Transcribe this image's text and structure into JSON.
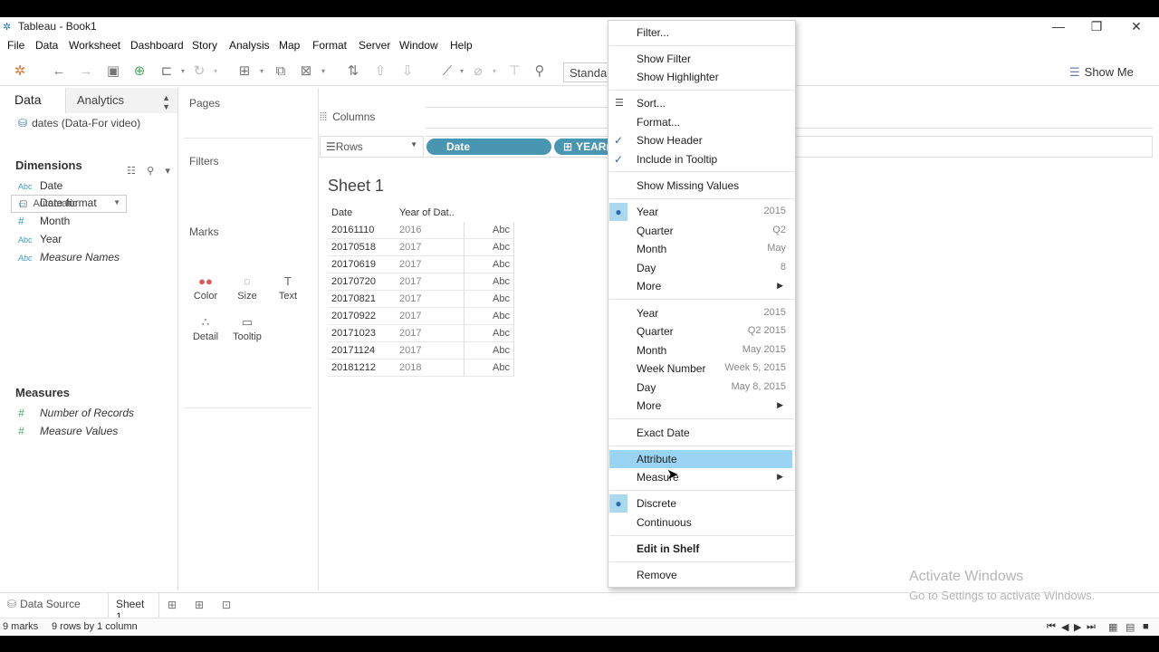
{
  "app": {
    "title": "Tableau - Book1",
    "logo_icon": "tableau-logo-icon"
  },
  "menus": [
    "File",
    "Data",
    "Worksheet",
    "Dashboard",
    "Story",
    "Analysis",
    "Map",
    "Format",
    "Server",
    "Window",
    "Help"
  ],
  "toolbar": {
    "fit_label": "Standa",
    "show_me_label": "Show Me"
  },
  "left_pane": {
    "data_tab": "Data",
    "analytics_tab": "Analytics",
    "datasource": "dates (Data-For video)",
    "dimensions_title": "Dimensions",
    "dimensions": [
      {
        "type": "Abc",
        "name": "Date"
      },
      {
        "type": "▭",
        "name": "Date format"
      },
      {
        "type": "#",
        "name": "Month"
      },
      {
        "type": "Abc",
        "name": "Year"
      },
      {
        "type": "Abc",
        "name": "Measure Names"
      }
    ],
    "measures_title": "Measures",
    "measures": [
      {
        "type": "#",
        "name": "Number of Records"
      },
      {
        "type": "#",
        "name": "Measure Values"
      }
    ]
  },
  "cards": {
    "pages": "Pages",
    "filters": "Filters",
    "marks": "Marks",
    "mark_type": "Automatic",
    "mark_buttons": [
      {
        "icon": "●●",
        "label": "Color"
      },
      {
        "icon": "◌",
        "label": "Size"
      },
      {
        "icon": "T",
        "label": "Text"
      },
      {
        "icon": "∴",
        "label": "Detail"
      },
      {
        "icon": "▭",
        "label": "Tooltip"
      }
    ]
  },
  "shelves": {
    "columns_label": "Columns",
    "rows_label": "Rows",
    "row_pills": [
      "Date",
      "YEAR("
    ]
  },
  "sheet": {
    "title": "Sheet 1",
    "headers": [
      "Date",
      "Year of Dat.."
    ],
    "rows": [
      {
        "date": "20161110",
        "year": "2016",
        "value": "Abc"
      },
      {
        "date": "20170518",
        "year": "2017",
        "value": "Abc"
      },
      {
        "date": "20170619",
        "year": "2017",
        "value": "Abc"
      },
      {
        "date": "20170720",
        "year": "2017",
        "value": "Abc"
      },
      {
        "date": "20170821",
        "year": "2017",
        "value": "Abc"
      },
      {
        "date": "20170922",
        "year": "2017",
        "value": "Abc"
      },
      {
        "date": "20171023",
        "year": "2017",
        "value": "Abc"
      },
      {
        "date": "20171124",
        "year": "2017",
        "value": "Abc"
      },
      {
        "date": "20181212",
        "year": "2018",
        "value": "Abc"
      }
    ]
  },
  "context_menu": {
    "filter": "Filter...",
    "show_filter": "Show Filter",
    "show_highlighter": "Show Highlighter",
    "sort": "Sort...",
    "format": "Format...",
    "show_header": "Show Header",
    "include_tooltip": "Include in Tooltip",
    "show_missing": "Show Missing Values",
    "discrete_dates": [
      {
        "label": "Year",
        "sample": "2015"
      },
      {
        "label": "Quarter",
        "sample": "Q2"
      },
      {
        "label": "Month",
        "sample": "May"
      },
      {
        "label": "Day",
        "sample": "8"
      }
    ],
    "more_1": "More",
    "continuous_dates": [
      {
        "label": "Year",
        "sample": "2015"
      },
      {
        "label": "Quarter",
        "sample": "Q2 2015"
      },
      {
        "label": "Month",
        "sample": "May 2015"
      },
      {
        "label": "Week Number",
        "sample": "Week 5, 2015"
      },
      {
        "label": "Day",
        "sample": "May 8, 2015"
      }
    ],
    "more_2": "More",
    "exact_date": "Exact Date",
    "attribute": "Attribute",
    "measure": "Measure",
    "discrete": "Discrete",
    "continuous": "Continuous",
    "edit_in_shelf": "Edit in Shelf",
    "remove": "Remove"
  },
  "watermark": {
    "line1": "Activate Windows",
    "line2": "Go to Settings to activate Windows."
  },
  "tabs": {
    "data_source": "Data Source",
    "sheet1": "Sheet 1"
  },
  "status": {
    "marks": "9 marks",
    "rows": "9 rows by 1 column"
  },
  "colors": {
    "pill": "#4996b2",
    "highlight": "#99d4f4",
    "check": "#a9d8ef"
  }
}
